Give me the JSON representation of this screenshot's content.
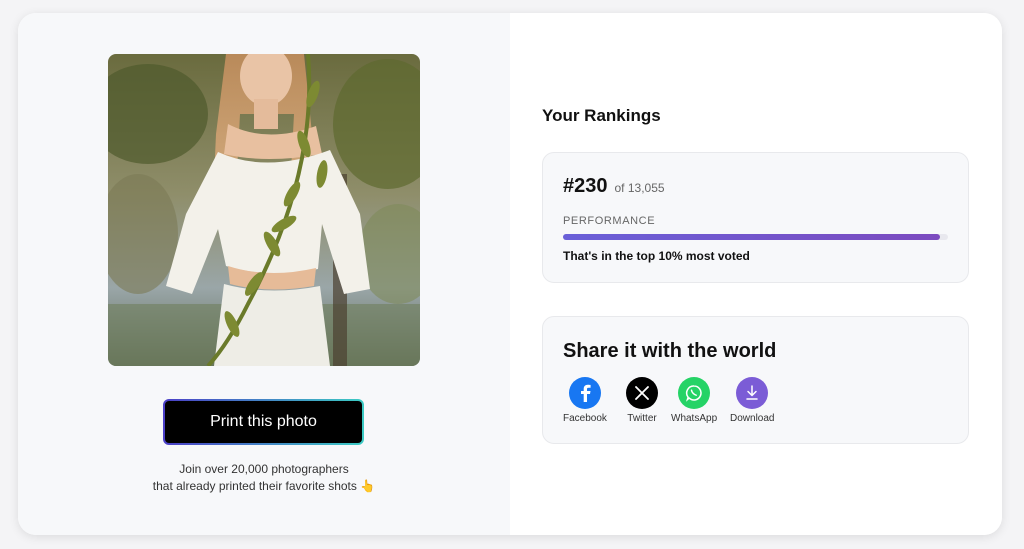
{
  "left": {
    "print_button": "Print this photo",
    "join_line1": "Join over 20,000 photographers",
    "join_line2": "that already printed their favorite shots",
    "join_emoji": "👆"
  },
  "rankings": {
    "heading": "Your Rankings",
    "rank": "#230",
    "of_total": "of 13,055",
    "performance_label": "PERFORMANCE",
    "performance_fraction": 0.98,
    "note": "That's in the top 10% most voted"
  },
  "share": {
    "title": "Share it with the world",
    "items": [
      {
        "label": "Facebook",
        "icon": "facebook-icon",
        "color": "#1877f2"
      },
      {
        "label": "Twitter",
        "icon": "x-icon",
        "color": "#000000"
      },
      {
        "label": "WhatsApp",
        "icon": "whatsapp-icon",
        "color": "#25d366"
      },
      {
        "label": "Download",
        "icon": "download-icon",
        "color": "#7b5cd6"
      }
    ]
  }
}
